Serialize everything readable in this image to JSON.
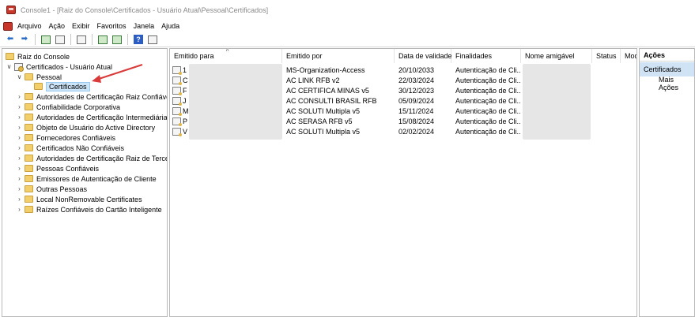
{
  "window": {
    "title": "Console1 - [Raiz do Console\\Certificados - Usuário Atual\\Pessoal\\Certificados]"
  },
  "menu": [
    "Arquivo",
    "Ação",
    "Exibir",
    "Favoritos",
    "Janela",
    "Ajuda"
  ],
  "toolbar": {
    "icons": [
      "back-arrow-icon",
      "forward-arrow-icon",
      "up-folder-icon",
      "show-hide-tree-icon",
      "properties-icon",
      "refresh-icon",
      "export-list-icon",
      "help-icon",
      "show-hide-action-pane-icon"
    ]
  },
  "tree": {
    "root": "Raiz do Console",
    "store": "Certificados - Usuário Atual",
    "personal": "Pessoal",
    "selected": "Certificados",
    "folders": [
      "Autoridades de Certificação Raiz Confiáveis",
      "Confiabilidade Corporativa",
      "Autoridades de Certificação Intermediárias",
      "Objeto de Usuário do Active Directory",
      "Fornecedores Confiáveis",
      "Certificados Não Confiáveis",
      "Autoridades de Certificação Raiz de Terceiros",
      "Pessoas Confiáveis",
      "Emissores de Autenticação de Cliente",
      "Outras Pessoas",
      "Local NonRemovable Certificates",
      "Raízes Confiáveis do Cartão Inteligente"
    ]
  },
  "list": {
    "columns": [
      "Emitido para",
      "Emitido por",
      "Data de validade",
      "Finalidades",
      "Nome amigável",
      "Status",
      "Mod"
    ],
    "rows": [
      {
        "issued_to": "1",
        "issued_by": "MS-Organization-Access",
        "expires": "20/10/2033",
        "purpose": "Autenticação de Cli..."
      },
      {
        "issued_to": "C",
        "issued_by": "AC LINK RFB v2",
        "expires": "22/03/2024",
        "purpose": "Autenticação de Cli..."
      },
      {
        "issued_to": "F",
        "issued_by": "AC CERTIFICA MINAS v5",
        "expires": "30/12/2023",
        "purpose": "Autenticação de Cli..."
      },
      {
        "issued_to": "J",
        "issued_by": "AC CONSULTI BRASIL RFB",
        "expires": "05/09/2024",
        "purpose": "Autenticação de Cli..."
      },
      {
        "issued_to": "M",
        "issued_by": "AC SOLUTI Multipla v5",
        "expires": "15/11/2024",
        "purpose": "Autenticação de Cli..."
      },
      {
        "issued_to": "P",
        "issued_by": "AC SERASA RFB v5",
        "expires": "15/08/2024",
        "purpose": "Autenticação de Cli..."
      },
      {
        "issued_to": "V",
        "issued_by": "AC SOLUTI Multipla v5",
        "expires": "02/02/2024",
        "purpose": "Autenticação de Cli..."
      }
    ]
  },
  "actions": {
    "header": "Ações",
    "section": "Certificados",
    "more": "Mais Ações"
  },
  "colors": {
    "selection": "#cce4f7",
    "action_section": "#cfe3f5",
    "annotation_arrow": "#d93a3a"
  }
}
